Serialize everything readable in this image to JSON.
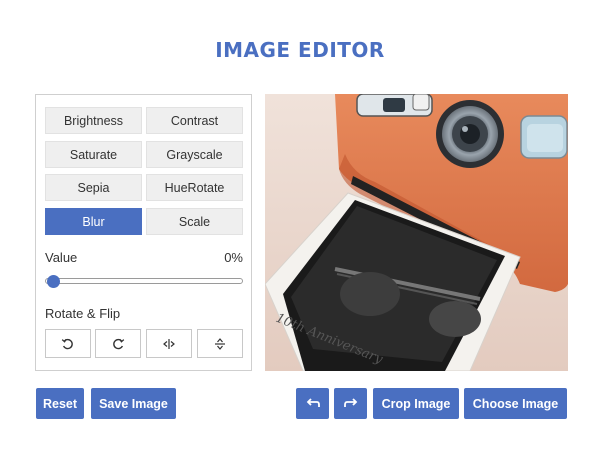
{
  "app": {
    "title": "IMAGE EDITOR"
  },
  "filters": [
    {
      "label": "Brightness",
      "active": false
    },
    {
      "label": "Contrast",
      "active": false
    },
    {
      "label": "Saturate",
      "active": false
    },
    {
      "label": "Grayscale",
      "active": false
    },
    {
      "label": "Sepia",
      "active": false
    },
    {
      "label": "HueRotate",
      "active": false
    },
    {
      "label": "Blur",
      "active": true
    },
    {
      "label": "Scale",
      "active": false
    }
  ],
  "value": {
    "label": "Value",
    "display": "0%",
    "level": 0
  },
  "rotate": {
    "label": "Rotate & Flip",
    "buttons": [
      {
        "icon": "rotate-left-icon"
      },
      {
        "icon": "rotate-right-icon"
      },
      {
        "icon": "flip-horizontal-icon"
      },
      {
        "icon": "flip-vertical-icon"
      }
    ]
  },
  "preview": {
    "caption": "10th Anniversary",
    "description_icon": "instant-camera-photo"
  },
  "actions": {
    "reset": "Reset",
    "save": "Save Image",
    "undo_icon": "undo-icon",
    "redo_icon": "redo-icon",
    "crop": "Crop Image",
    "choose": "Choose Image"
  },
  "colors": {
    "accent": "#4a6fc1",
    "camera": "#e17a4e",
    "background": "#e8d5cc"
  }
}
